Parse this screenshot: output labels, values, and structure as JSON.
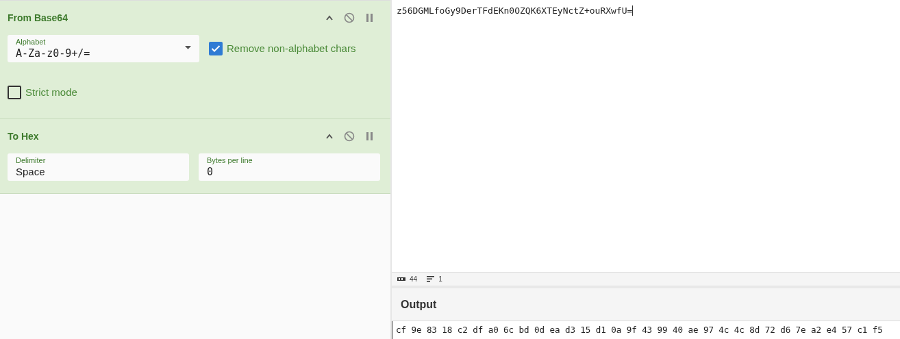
{
  "recipe": [
    {
      "title": "From Base64",
      "fields": [
        {
          "kind": "dropdown",
          "label": "Alphabet",
          "value": "A-Za-z0-9+/=",
          "mono": true
        },
        {
          "kind": "checkbox",
          "label": "Remove non-alphabet chars",
          "checked": true
        },
        {
          "kind": "checkbox",
          "label": "Strict mode",
          "checked": false
        }
      ]
    },
    {
      "title": "To Hex",
      "fields": [
        {
          "kind": "text",
          "label": "Delimiter",
          "value": "Space",
          "mono": false
        },
        {
          "kind": "text",
          "label": "Bytes per line",
          "value": "0",
          "mono": true
        }
      ]
    }
  ],
  "input": {
    "text": "z56DGMLfoGy9DerTFdEKn0OZQK6XTEyNctZ+ouRXwfU=",
    "length": "44",
    "lines": "1"
  },
  "output": {
    "title": "Output",
    "text": "cf 9e 83 18 c2 df a0 6c bd 0d ea d3 15 d1 0a 9f 43 99 40 ae 97 4c 4c 8d 72 d6 7e a2 e4 57 c1 f5"
  }
}
